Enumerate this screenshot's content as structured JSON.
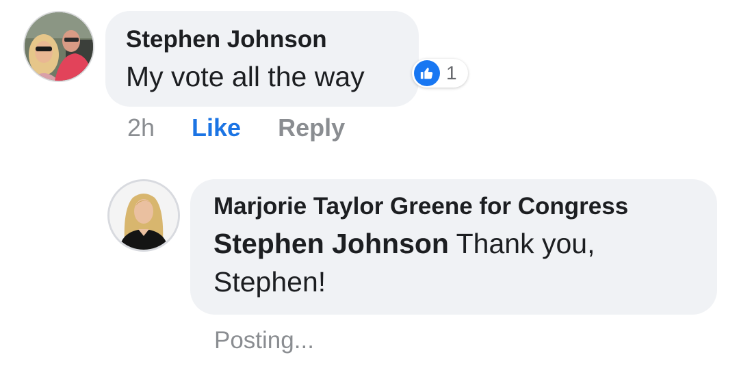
{
  "comment": {
    "author": "Stephen Johnson",
    "text": "My vote all the way",
    "reaction": {
      "icon": "like-thumbs-up-icon",
      "count": "1",
      "color": "#1877f2"
    },
    "actions": {
      "timestamp": "2h",
      "like_label": "Like",
      "reply_label": "Reply"
    }
  },
  "reply": {
    "author": "Marjorie Taylor Greene for Congress",
    "mention": "Stephen Johnson",
    "text_line1": " Thank you,",
    "text_line2": "Stephen!",
    "status": "Posting..."
  },
  "colors": {
    "bubble": "#f0f2f5",
    "link_active": "#1b74e4",
    "muted_text": "#8a8d91"
  }
}
